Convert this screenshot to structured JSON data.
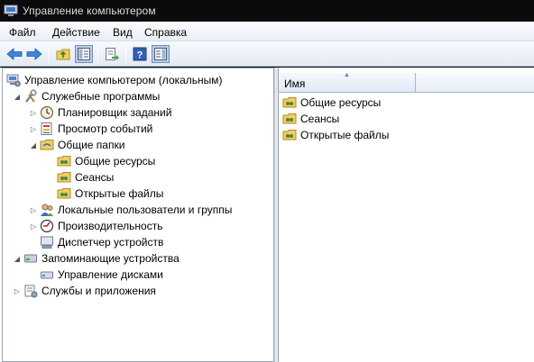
{
  "window": {
    "title": "Управление компьютером"
  },
  "menu": {
    "file": "Файл",
    "action": "Действие",
    "view": "Вид",
    "help": "Справка"
  },
  "toolbar": {
    "icons": [
      "back-arrow-icon",
      "forward-arrow-icon",
      "up-folder-icon",
      "show-hide-tree-icon",
      "export-list-icon",
      "help-icon",
      "properties-icon"
    ]
  },
  "tree": {
    "root": "Управление компьютером (локальным)",
    "system_tools": "Служебные программы",
    "task_scheduler": "Планировщик заданий",
    "event_viewer": "Просмотр событий",
    "shared_folders": "Общие папки",
    "shares": "Общие ресурсы",
    "sessions": "Сеансы",
    "open_files": "Открытые файлы",
    "local_users": "Локальные пользователи и группы",
    "performance": "Производительность",
    "device_manager": "Диспетчер устройств",
    "storage": "Запоминающие устройства",
    "disk_management": "Управление дисками",
    "services_apps": "Службы и приложения"
  },
  "list": {
    "column_name": "Имя",
    "items": [
      "Общие ресурсы",
      "Сеансы",
      "Открытые файлы"
    ]
  }
}
